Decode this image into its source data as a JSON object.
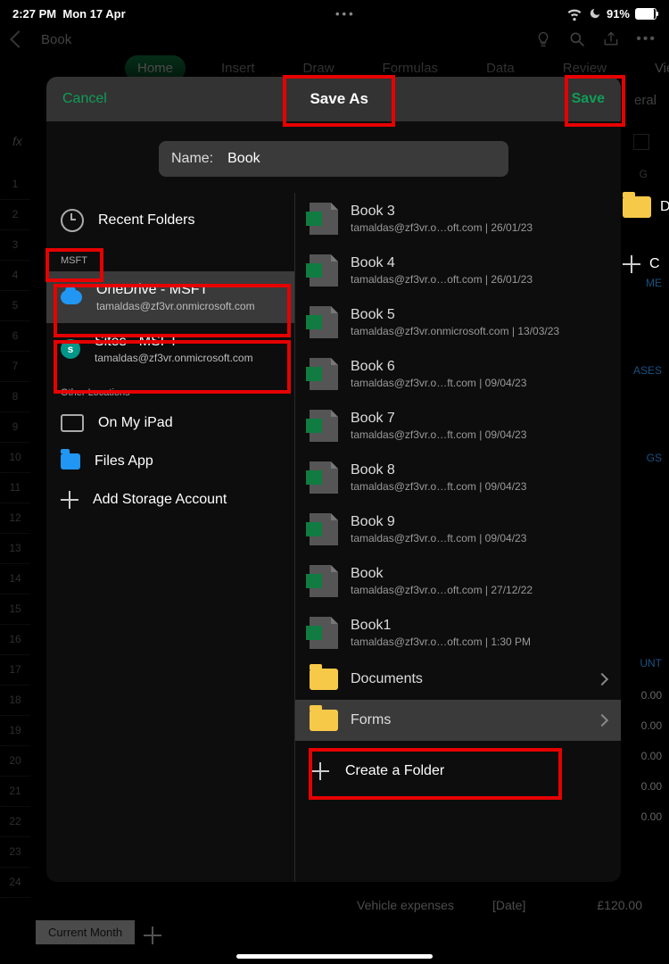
{
  "status": {
    "time": "2:27 PM",
    "date": "Mon 17 Apr",
    "battery": "91%"
  },
  "app": {
    "title": "Book"
  },
  "ribbon": {
    "tabs": [
      "Home",
      "Insert",
      "Draw",
      "Formulas",
      "Data",
      "Review",
      "View"
    ],
    "extra": "eral"
  },
  "modal": {
    "cancel": "Cancel",
    "title": "Save As",
    "save": "Save",
    "name_label": "Name:",
    "name_value": "Book",
    "recent": "Recent Folders",
    "acct_section": "MSFT",
    "onedrive": {
      "title": "OneDrive - MSFT",
      "sub": "tamaldas@zf3vr.onmicrosoft.com"
    },
    "sites": {
      "title": "Sites - MSFT",
      "sub": "tamaldas@zf3vr.onmicrosoft.com"
    },
    "other_section": "Other Locations",
    "on_ipad": "On My iPad",
    "files_app": "Files App",
    "add_storage": "Add Storage Account",
    "files": [
      {
        "name": "Book 3",
        "meta": "tamaldas@zf3vr.o…oft.com | 26/01/23"
      },
      {
        "name": "Book 4",
        "meta": "tamaldas@zf3vr.o…oft.com | 26/01/23"
      },
      {
        "name": "Book 5",
        "meta": "tamaldas@zf3vr.onmicrosoft.com | 13/03/23"
      },
      {
        "name": "Book 6",
        "meta": "tamaldas@zf3vr.o…ft.com | 09/04/23"
      },
      {
        "name": "Book 7",
        "meta": "tamaldas@zf3vr.o…ft.com | 09/04/23"
      },
      {
        "name": "Book 8",
        "meta": "tamaldas@zf3vr.o…ft.com | 09/04/23"
      },
      {
        "name": "Book 9",
        "meta": "tamaldas@zf3vr.o…ft.com | 09/04/23"
      },
      {
        "name": "Book",
        "meta": "tamaldas@zf3vr.o…oft.com | 27/12/22"
      },
      {
        "name": "Book1",
        "meta": "tamaldas@zf3vr.o…oft.com | 1:30 PM"
      }
    ],
    "folders": [
      {
        "name": "Documents"
      },
      {
        "name": "Forms"
      }
    ],
    "create_folder": "Create a Folder"
  },
  "drive": {
    "d": "D",
    "c": "C"
  },
  "bg": {
    "formula": "fx",
    "col": "G",
    "rows": [
      "1",
      "2",
      "3",
      "4",
      "5",
      "6",
      "7",
      "8",
      "9",
      "10",
      "11",
      "12",
      "13",
      "14",
      "15",
      "16",
      "17",
      "18",
      "19",
      "20",
      "21",
      "22",
      "23",
      "24"
    ],
    "hints": [
      "ME",
      "ASES",
      "GS",
      "UNT",
      "0.00",
      "0.00",
      "0.00",
      "0.00",
      "0.00"
    ],
    "vehicle": "Vehicle expenses",
    "date": "[Date]",
    "amount": "£120.00",
    "sheet_tab": "Current Month"
  }
}
